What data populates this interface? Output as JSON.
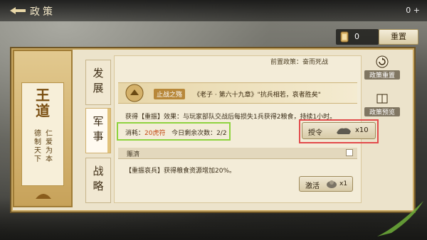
{
  "header": {
    "title": "政策",
    "right_text": "0 +"
  },
  "resources": {
    "count": "0",
    "reset_label": "重置"
  },
  "emblem": {
    "title": "王道",
    "motto_col1": "仁爱为本",
    "motto_col2": "德制天下"
  },
  "tabs": [
    {
      "label": "发展",
      "active": false
    },
    {
      "label": "军事",
      "active": true
    },
    {
      "label": "战略",
      "active": false
    }
  ],
  "prerequisite": "前置政策：奋而死战",
  "policy": {
    "name": "止战之殇",
    "quote": "《老子 · 第六十九章》\"抗兵相若，哀者胜矣\"",
    "effect": "获得【重振】效果：与玩家部队交战后每损失1兵获得2粮食，持续1小时。",
    "cost_prefix": "消耗：",
    "cost_value": "20虎符",
    "cost_suffix": "今日剩余次数：2/2",
    "authorize_label": "授令",
    "authorize_amount": "x10"
  },
  "relief": {
    "section_label": "赈濟",
    "text": "【重振哀兵】获得粮食资源增加20%。",
    "activate_label": "激活",
    "activate_amount": "x1"
  },
  "side_controls": [
    {
      "label": "政策重置",
      "icon": "rotate-icon"
    },
    {
      "label": "政策预览",
      "icon": "book-icon"
    }
  ],
  "colors": {
    "highlight_green": "#8ed33f",
    "highlight_red": "#e24b4b",
    "panel_gold": "#c9a862",
    "cost_orange": "#c14a17"
  }
}
